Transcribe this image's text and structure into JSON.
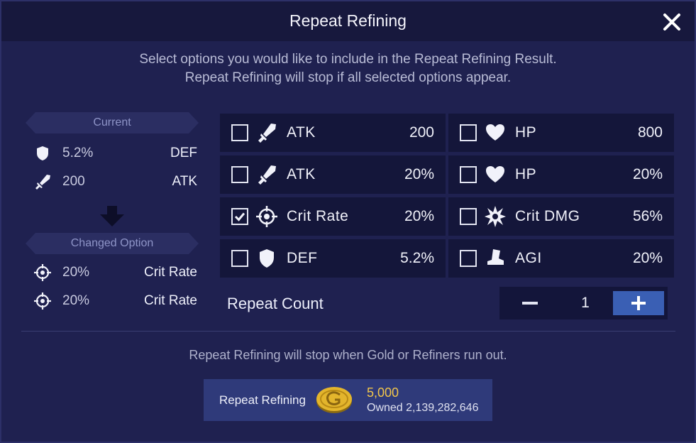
{
  "dialog": {
    "title": "Repeat Refining",
    "instructions": [
      "Select options you would like to include in the Repeat Refining Result.",
      "Repeat Refining will stop if all selected options appear."
    ]
  },
  "current": {
    "header": "Current",
    "stats": [
      {
        "icon": "shield-icon",
        "value": "5.2%",
        "name": "DEF"
      },
      {
        "icon": "sword-icon",
        "value": "200",
        "name": "ATK"
      }
    ]
  },
  "changed": {
    "header": "Changed Option",
    "stats": [
      {
        "icon": "crosshair-icon",
        "value": "20%",
        "name": "Crit Rate"
      },
      {
        "icon": "crosshair-icon",
        "value": "20%",
        "name": "Crit Rate"
      }
    ]
  },
  "options": [
    {
      "icon": "sword-icon",
      "name": "ATK",
      "value": "200",
      "checked": false
    },
    {
      "icon": "heart-icon",
      "name": "HP",
      "value": "800",
      "checked": false
    },
    {
      "icon": "sword-icon",
      "name": "ATK",
      "value": "20%",
      "checked": false
    },
    {
      "icon": "heart-icon",
      "name": "HP",
      "value": "20%",
      "checked": false
    },
    {
      "icon": "crosshair-icon",
      "name": "Crit Rate",
      "value": "20%",
      "checked": true
    },
    {
      "icon": "burst-icon",
      "name": "Crit DMG",
      "value": "56%",
      "checked": false
    },
    {
      "icon": "shield-icon",
      "name": "DEF",
      "value": "5.2%",
      "checked": false
    },
    {
      "icon": "boot-icon",
      "name": "AGI",
      "value": "20%",
      "checked": false
    }
  ],
  "repeat_count": {
    "label": "Repeat Count",
    "value": "1"
  },
  "footer": {
    "note": "Repeat Refining will stop when Gold or Refiners run out.",
    "button_label": "Repeat Refining",
    "cost": "5,000",
    "owned": "Owned 2,139,282,646"
  },
  "colors": {
    "background": "#1f2150",
    "panel": "#14163a",
    "accent_blue": "#3a5fb4",
    "gold": "#f1c54b",
    "side_header": "#8f95c8"
  }
}
